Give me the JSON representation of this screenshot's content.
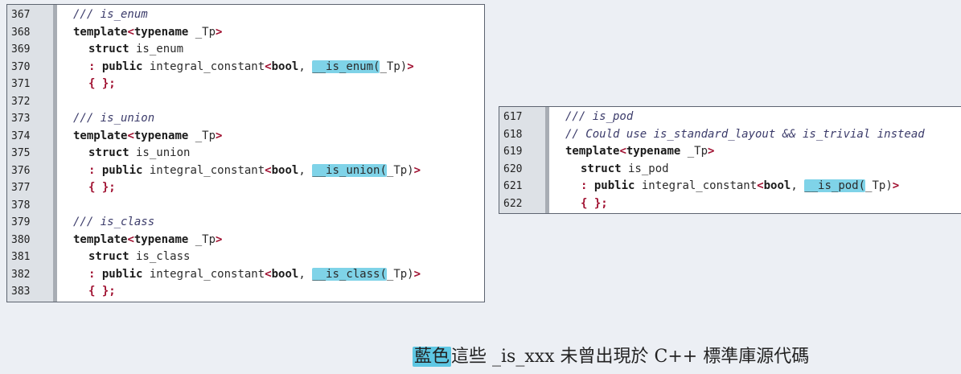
{
  "left_panel": {
    "lines": [
      {
        "n": "367",
        "c": "/// is_enum"
      },
      {
        "n": "368",
        "a": "template",
        "b": "<",
        "d": "typename",
        "e": " _Tp",
        "f": ">"
      },
      {
        "n": "369",
        "a": "struct",
        "e": " is_enum"
      },
      {
        "n": "370",
        "p": ": ",
        "a": "public",
        "e": " integral_constant",
        "b": "<",
        "d": "bool",
        "g": ", ",
        "h": "__is_enum(",
        "i": "_Tp)",
        "f": ">"
      },
      {
        "n": "371",
        "s": "{ };"
      },
      {
        "n": "372"
      },
      {
        "n": "373",
        "c": "/// is_union"
      },
      {
        "n": "374",
        "a": "template",
        "b": "<",
        "d": "typename",
        "e": " _Tp",
        "f": ">"
      },
      {
        "n": "375",
        "a": "struct",
        "e": " is_union"
      },
      {
        "n": "376",
        "p": ": ",
        "a": "public",
        "e": " integral_constant",
        "b": "<",
        "d": "bool",
        "g": ", ",
        "h": "__is_union(",
        "i": "_Tp)",
        "f": ">"
      },
      {
        "n": "377",
        "s": "{ };"
      },
      {
        "n": "378"
      },
      {
        "n": "379",
        "c": "/// is_class"
      },
      {
        "n": "380",
        "a": "template",
        "b": "<",
        "d": "typename",
        "e": " _Tp",
        "f": ">"
      },
      {
        "n": "381",
        "a": "struct",
        "e": " is_class"
      },
      {
        "n": "382",
        "p": ": ",
        "a": "public",
        "e": " integral_constant",
        "b": "<",
        "d": "bool",
        "g": ", ",
        "h": "__is_class(",
        "i": "_Tp)",
        "f": ">"
      },
      {
        "n": "383",
        "s": "{ };"
      }
    ]
  },
  "right_panel": {
    "lines": [
      {
        "n": "617",
        "c": "/// is_pod"
      },
      {
        "n": "618",
        "c": "// Could use is_standard_layout && is_trivial instead"
      },
      {
        "n": "619",
        "a": "template",
        "b": "<",
        "d": "typename",
        "e": " _Tp",
        "f": ">"
      },
      {
        "n": "620",
        "a": "struct",
        "e": " is_pod"
      },
      {
        "n": "621",
        "p": ": ",
        "a": "public",
        "e": " integral_constant",
        "b": "<",
        "d": "bool",
        "g": ", ",
        "h": "__is_pod(",
        "i": "_Tp)",
        "f": ">"
      },
      {
        "n": "622",
        "s": "{ };"
      }
    ]
  },
  "caption": {
    "highlight": "藍色",
    "rest": "這些 _is_xxx 未曾出現於 C++ 標準庫源代碼"
  },
  "colors": {
    "highlight": "#7fd3e8",
    "symbol": "#a01030"
  }
}
